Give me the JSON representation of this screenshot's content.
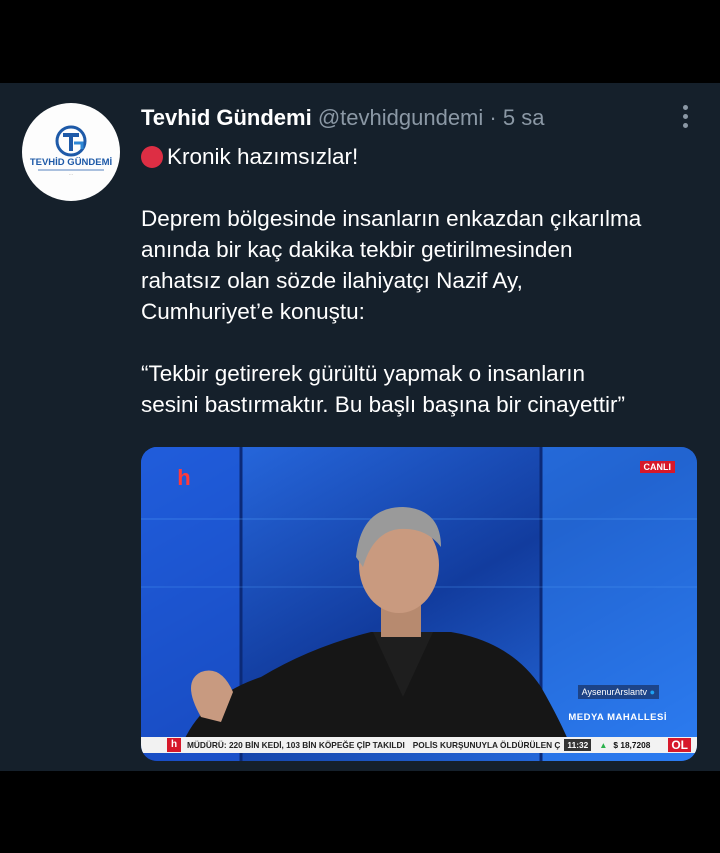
{
  "tweet": {
    "display_name": "Tevhid Gündemi",
    "handle": "@tevhidgundemi",
    "separator": "·",
    "timestamp": "5 sa",
    "emoji": "red-circle",
    "headline": "Kronik hazımsızlar!",
    "body_paragraph": [
      "Deprem bölgesinde insanların enkazdan çıkarılma",
      "anında bir kaç dakika tekbir getirilmesinden",
      "rahatsız olan sözde ilahiyatçı Nazif Ay,",
      "Cumhuriyet’e konuştu:"
    ],
    "quote_lines": [
      "“Tekbir getirerek gürültü yapmak o insanların",
      "sesini bastırmaktır. Bu başlı başına bir cinayettir”"
    ]
  },
  "avatar": {
    "logo_text": "TEVHİD GÜNDEMİ",
    "logo_initials": "TG"
  },
  "media": {
    "live_badge": "CANLI",
    "channel_logo": "h",
    "social_handle": "AysenurArslantv",
    "show_name": "MEDYA MAHALLESİ",
    "ticker_text": "MÜDÜRÜ: 220 BİN KEDİ, 103 BİN KÖPEĞE ÇİP TAKILDI",
    "ticker_text2": "POLİS KURŞUNUYLA ÖLDÜRÜLEN Ç",
    "ticker_time": "11:32",
    "ticker_rate": "$ 18,7208",
    "ticker_badge": "OL"
  },
  "colors": {
    "background": "#15202b",
    "muted_text": "#8b98a5",
    "primary_text": "#ffffff",
    "red_emoji": "#dd2e44",
    "studio_blue": "#1a4fd0"
  }
}
